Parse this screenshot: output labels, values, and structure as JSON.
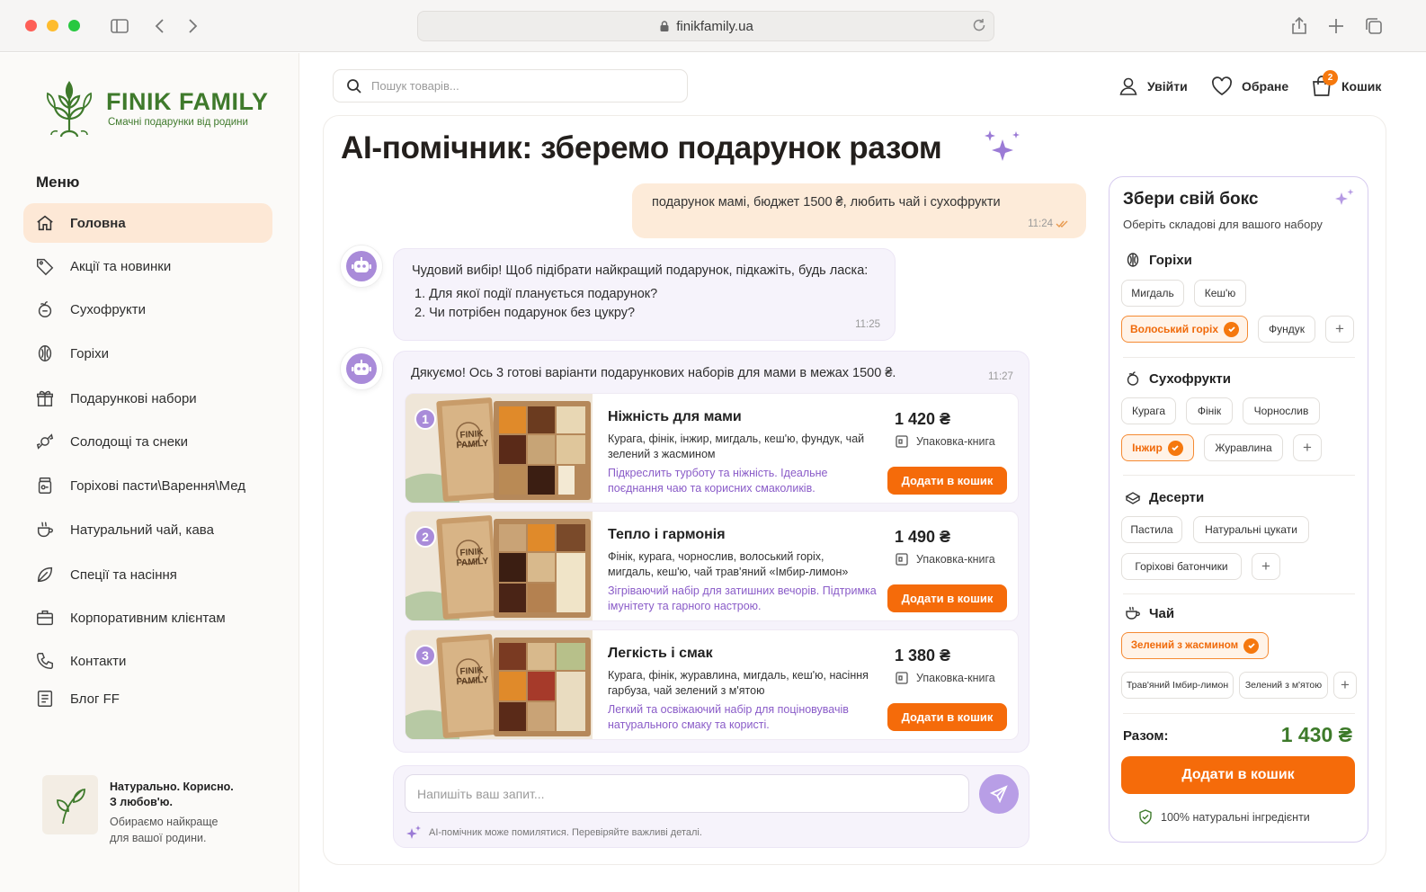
{
  "browser": {
    "url": "finikfamily.ua"
  },
  "brand": {
    "name": "FINIK FAMILY",
    "tagline": "Смачні подарунки від родини"
  },
  "sidebar": {
    "menu_title": "Меню",
    "items": [
      {
        "label": "Головна",
        "icon": "home-icon",
        "active": true
      },
      {
        "label": "Акції та новинки",
        "icon": "tag-icon"
      },
      {
        "label": "Сухофрукти",
        "icon": "fruit-icon"
      },
      {
        "label": "Горіхи",
        "icon": "nut-icon"
      },
      {
        "label": "Подарункові набори",
        "icon": "gift-icon"
      },
      {
        "label": "Солодощі та снеки",
        "icon": "candy-icon"
      },
      {
        "label": "Горіхові пасти\\Варення\\Мед",
        "icon": "jar-icon"
      },
      {
        "label": "Натуральний чай, кава",
        "icon": "cup-icon"
      },
      {
        "label": "Спеції та насіння",
        "icon": "leaf-icon"
      },
      {
        "label": "Корпоративним клієнтам",
        "icon": "briefcase-icon"
      },
      {
        "label": "Контакти",
        "icon": "phone-icon"
      },
      {
        "label": "Блог FF",
        "icon": "blog-icon"
      }
    ],
    "promo": {
      "title_line1": "Натурально. Корисно.",
      "title_line2": "З любов'ю.",
      "text_line1": "Обираємо найкраще",
      "text_line2": "для вашої родини."
    }
  },
  "header": {
    "search_placeholder": "Пошук товарів...",
    "login": "Увійти",
    "favorites": "Обране",
    "cart": "Кошик",
    "cart_count": "2"
  },
  "chat": {
    "title": "AI-помічник: зберемо подарунок разом",
    "user_message": {
      "text": "подарунок мамі, бюджет 1500 ₴, любить чай і сухофрукти",
      "time": "11:24"
    },
    "bot_message_1": {
      "intro": "Чудовий вибір! Щоб підібрати найкращий подарунок, підкажіть, будь ласка:",
      "q1": "1.  Для якої події планується подарунок?",
      "q2": "2.  Чи потрібен подарунок без цукру?",
      "time": "11:25"
    },
    "bot_message_2": {
      "text": "Дякуємо! Ось 3 готові варіанти подарункових наборів для мами в межах 1500 ₴.",
      "time": "11:27"
    },
    "products": [
      {
        "num": "1",
        "title": "Ніжність для мами",
        "desc": "Курага, фінік, інжир, мигдаль, кеш'ю, фундук, чай зелений з жасмином",
        "note": "Підкреслить турботу та ніжність. Ідеальне поєднання чаю та корисних смаколиків.",
        "price": "1 420 ₴",
        "pack": "Упаковка-книга",
        "button": "Додати в кошик",
        "box_text": "FINIK FAMILY"
      },
      {
        "num": "2",
        "title": "Тепло і гармонія",
        "desc": "Фінік, курага, чорнослив, волоський горіх, мигдаль, кеш'ю, чай трав'яний «Імбир-лимон»",
        "note": "Зігріваючий набір для затишних вечорів. Підтримка імунітету та гарного настрою.",
        "price": "1 490 ₴",
        "pack": "Упаковка-книга",
        "button": "Додати в кошик",
        "box_text": "FINIK FAMILY"
      },
      {
        "num": "3",
        "title": "Легкість і смак",
        "desc": "Курага, фінік, журавлина, мигдаль, кеш'ю, насіння гарбуза, чай зелений з м'ятою",
        "note": "Легкий та освіжаючий набір для поціновувачів натурального смаку та користі.",
        "price": "1 380 ₴",
        "pack": "Упаковка-книга",
        "button": "Додати в кошик",
        "box_text": "FINIK FAMILY"
      }
    ],
    "input_placeholder": "Напишіть ваш запит...",
    "disclaimer": "AI-помічник може помилятися. Перевіряйте важливі деталі."
  },
  "builder": {
    "title": "Збери свій бокс",
    "subtitle": "Оберіть складові для вашого набору",
    "sections": [
      {
        "name": "Горіхи",
        "icon": "nut-icon",
        "chips": [
          {
            "label": "Мигдаль"
          },
          {
            "label": "Кеш'ю"
          },
          {
            "label": "Волоський горіх",
            "selected": true
          },
          {
            "label": "Фундук"
          },
          {
            "label": "+"
          }
        ]
      },
      {
        "name": "Сухофрукти",
        "icon": "fruit-icon",
        "chips": [
          {
            "label": "Курага"
          },
          {
            "label": "Фінік"
          },
          {
            "label": "Чорнослив"
          },
          {
            "label": "Інжир",
            "selected": true
          },
          {
            "label": "Журавлина"
          },
          {
            "label": "+"
          }
        ]
      },
      {
        "name": "Десерти",
        "icon": "dessert-icon",
        "chips": [
          {
            "label": "Пастила"
          },
          {
            "label": "Натуральні цукати"
          },
          {
            "label": "Горіхові батончики"
          },
          {
            "label": "+"
          }
        ]
      },
      {
        "name": "Чай",
        "icon": "tea-icon",
        "chips": [
          {
            "label": "Зелений з жасмином",
            "selected": true
          },
          {
            "label": "Трав'яний Імбир-лимон"
          },
          {
            "label": "Зелений з м'ятою"
          },
          {
            "label": "+"
          }
        ]
      }
    ],
    "total_label": "Разом:",
    "total_value": "1 430 ₴",
    "button": "Додати в кошик",
    "natural": "100% натуральні інгредієнти"
  },
  "colors": {
    "accent": "#f56b0a",
    "brand_green": "#3f7a2c",
    "bot_purple": "#a98bd9",
    "active_nav": "#fde8d6"
  }
}
